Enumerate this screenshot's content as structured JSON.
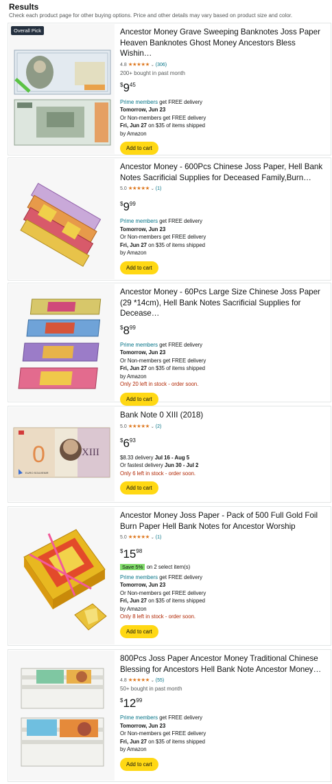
{
  "header": {
    "title": "Results",
    "subtitle": "Check each product page for other buying options. Price and other details may vary based on product size and color."
  },
  "colors": {
    "stars": "#DE7921",
    "link": "#007185",
    "button": "#FFD814",
    "stock": "#B12704",
    "badge": "#232F3E",
    "save": "#7FDA69"
  },
  "products": [
    {
      "badge": "Overall Pick",
      "title": "Ancestor Money Grave Sweeping Banknotes Joss Paper Heaven Banknotes Ghost Money Ancestors Bless Wishin…",
      "rating": "4.8",
      "stars": "★★★★★",
      "review_count": "(306)",
      "bought": "200+ bought in past month",
      "price_symbol": "$",
      "price_whole": "9",
      "price_fraction": "45",
      "prime_link": "Prime members",
      "prime_rest": " get FREE delivery",
      "prime_date": "Tomorrow, Jun 23",
      "nonmember": "Or Non-members get FREE delivery",
      "nonmember_date": "Fri, Jun 27",
      "nonmember_rest": " on $35 of items shipped",
      "shipped_by": "by Amazon",
      "button": "Add to cart",
      "image": "banknote-100-1000"
    },
    {
      "title": "Ancestor Money - 600Pcs Chinese Joss Paper, Hell Bank Notes Sacrificial Supplies for Deceased Family,Burn…",
      "rating": "5.0",
      "stars": "★★★★★",
      "review_count": "(1)",
      "price_symbol": "$",
      "price_whole": "9",
      "price_fraction": "99",
      "prime_link": "Prime members",
      "prime_rest": " get FREE delivery",
      "prime_date": "Tomorrow, Jun 23",
      "nonmember": "Or Non-members get FREE delivery",
      "nonmember_date": "Fri, Jun 27",
      "nonmember_rest": " on $35 of items shipped",
      "shipped_by": "by Amazon",
      "button": "Add to cart",
      "image": "fanned-hell-notes"
    },
    {
      "title": "Ancestor Money - 60Pcs Large Size Chinese Joss Paper (29 *14cm), Hell Bank Notes Sacrificial Supplies for Decease…",
      "price_symbol": "$",
      "price_whole": "8",
      "price_fraction": "99",
      "prime_link": "Prime members",
      "prime_rest": " get FREE delivery",
      "prime_date": "Tomorrow, Jun 23",
      "nonmember": "Or Non-members get FREE delivery",
      "nonmember_date": "Fri, Jun 27",
      "nonmember_rest": " on $35 of items shipped",
      "shipped_by": "by Amazon",
      "stock": "Only 20 left in stock - order soon.",
      "button": "Add to cart",
      "image": "stacked-note-bundles"
    },
    {
      "title": "Bank Note 0 XIII (2018)",
      "rating": "5.0",
      "stars": "★★★★★",
      "review_count": "(2)",
      "price_symbol": "$",
      "price_whole": "6",
      "price_fraction": "93",
      "delivery_prefix": "$8.33 delivery ",
      "delivery_date": "Jul 16 - Aug 5",
      "fastest_prefix": "Or fastest delivery ",
      "fastest_date": "Jun 30 - Jul 2",
      "stock": "Only 6 left in stock - order soon.",
      "button": "Add to cart",
      "image": "zero-euro-note",
      "note_text": {
        "zero": "0",
        "numeral": "XIII",
        "label": "EURO SOUVENIR"
      }
    },
    {
      "title": "Ancestor Money Joss Paper - Pack of 500 Full Gold Foil Burn Paper Hell Bank Notes for Ancestor Worship",
      "rating": "5.0",
      "stars": "★★★★★",
      "review_count": "(1)",
      "price_symbol": "$",
      "price_whole": "15",
      "price_fraction": "98",
      "save_badge": "Save 5%",
      "save_rest": " on 2 select item(s)",
      "prime_link": "Prime members",
      "prime_rest": " get FREE delivery",
      "prime_date": "Tomorrow, Jun 23",
      "nonmember": "Or Non-members get FREE delivery",
      "nonmember_date": "Fri, Jun 27",
      "nonmember_rest": " on $35 of items shipped",
      "shipped_by": "by Amazon",
      "stock": "Only 8 left in stock - order soon.",
      "button": "Add to cart",
      "image": "gold-foil-pack"
    },
    {
      "title": "800Pcs Joss Paper Ancestor Money Traditional Chinese Blessing for Ancestors Hell Bank Note Ancestor Money…",
      "rating": "4.8",
      "stars": "★★★★★",
      "review_count": "(55)",
      "bought": "50+ bought in past month",
      "price_symbol": "$",
      "price_whole": "12",
      "price_fraction": "99",
      "prime_link": "Prime members",
      "prime_rest": " get FREE delivery",
      "prime_date": "Tomorrow, Jun 23",
      "nonmember": "Or Non-members get FREE delivery",
      "nonmember_date": "Fri, Jun 27",
      "nonmember_rest": " on $35 of items shipped",
      "shipped_by": "by Amazon",
      "button": "Add to cart",
      "image": "two-note-stacks"
    }
  ]
}
